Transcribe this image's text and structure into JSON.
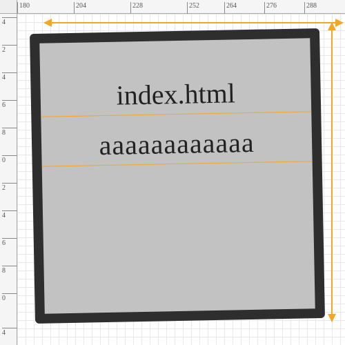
{
  "rulers": {
    "top_ticks": [
      "180",
      "204",
      "228",
      "252",
      "264",
      "276",
      "288"
    ],
    "left_ticks": [
      "4",
      "2",
      "4",
      "6",
      "8",
      "0",
      "2",
      "4",
      "6",
      "8",
      "0",
      "4"
    ]
  },
  "shape": {
    "text1": "index.html",
    "text2": "aaaaaaaaaaaa",
    "rotation_deg": -1.1,
    "border_color": "#2e2e2e",
    "fill_color": "#c2c2c2",
    "accent_color": "#f5a623"
  }
}
